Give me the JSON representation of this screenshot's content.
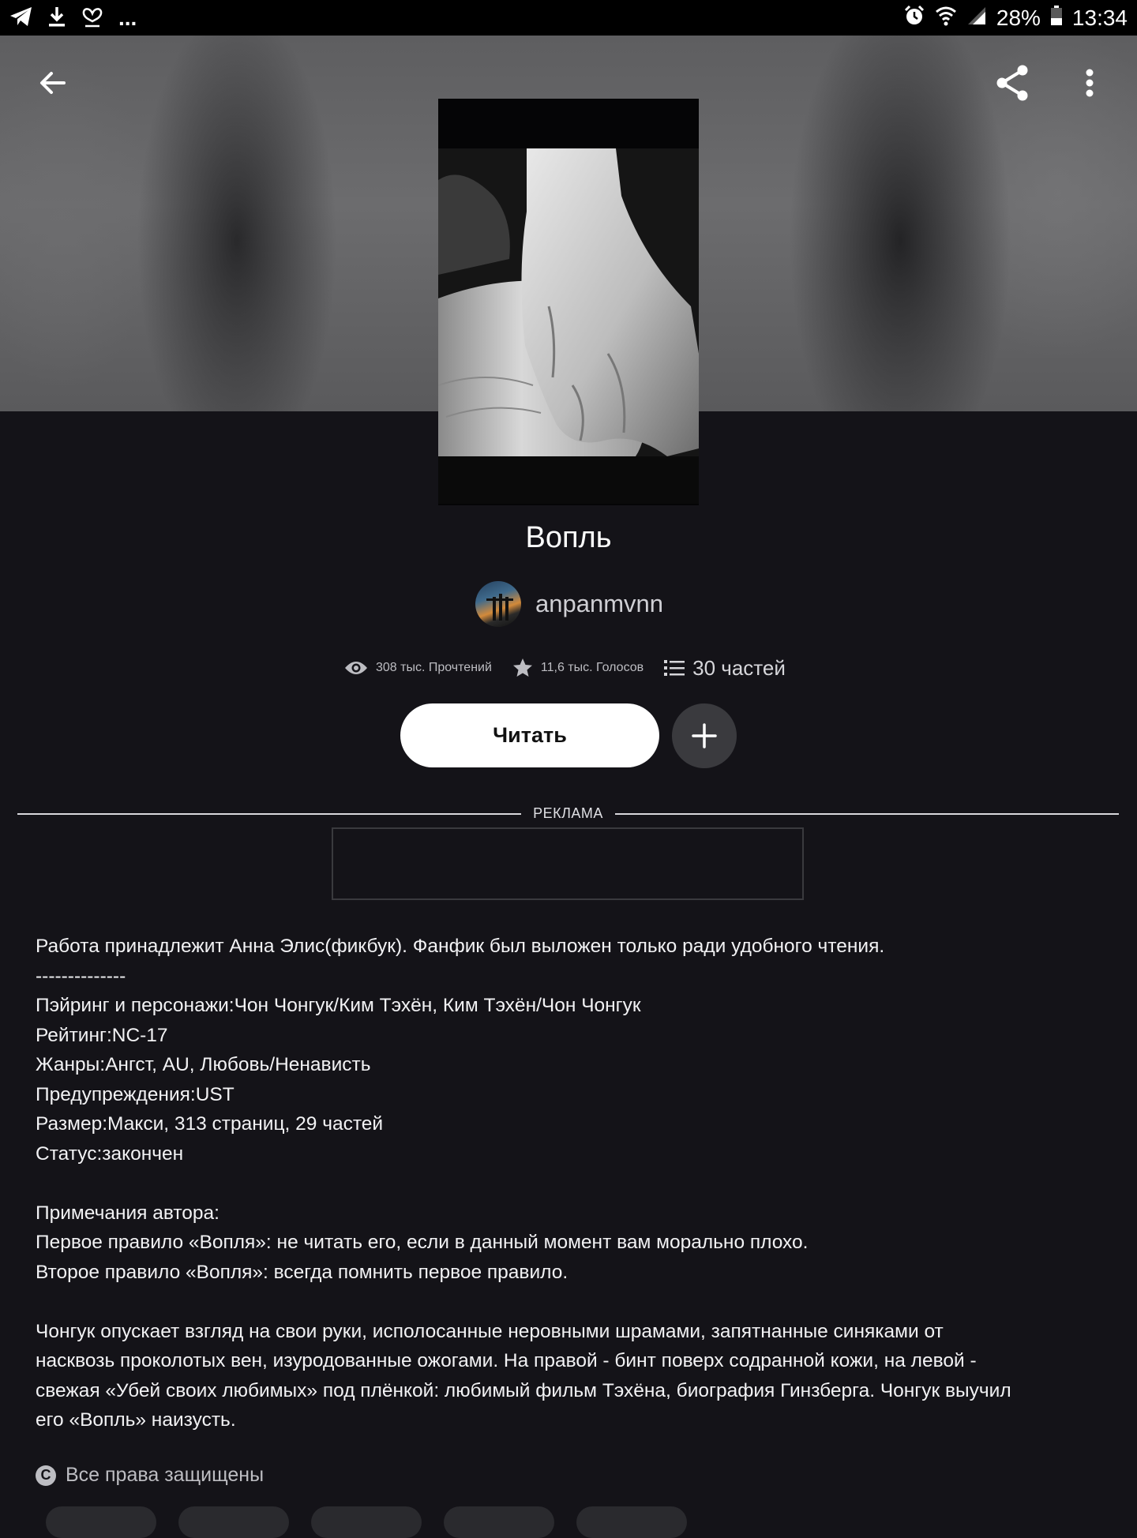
{
  "status_bar": {
    "left_icons": [
      "telegram-icon",
      "download-icon",
      "heart-ribbon-icon"
    ],
    "more": "...",
    "battery": "28%",
    "time": "13:34"
  },
  "header": {
    "back_icon": "arrow-left-icon",
    "share_icon": "share-icon",
    "more_icon": "more-vertical-icon"
  },
  "story": {
    "title": "Вопль",
    "author": "anpanmvnn",
    "reads": "308 тыс. Прочтений",
    "votes": "11,6 тыс. Голосов",
    "parts": "30 частей"
  },
  "actions": {
    "read_label": "Читать",
    "add_icon": "plus-icon"
  },
  "ad": {
    "label": "РЕКЛАМА"
  },
  "description": [
    "Работа принадлежит Анна Элис(фикбук). Фанфик был выложен только ради удобного чтения.",
    "--------------",
    "Пэйринг и персонажи:Чон Чонгук/Ким Тэхён, Ким Тэхён/Чон Чонгук",
    "Рейтинг:NC-17",
    "Жанры:Ангст, AU, Любовь/Ненависть",
    "Предупреждения:UST",
    "Размер:Макси, 313 страниц, 29 частей",
    "Статус:закончен",
    "",
    "Примечания автора:",
    "Первое правило «Вопля»: не читать его, если в данный момент вам морально плохо.",
    "Второе правило «Вопля»: всегда помнить первое правило.",
    "",
    "Чонгук опускает взгляд на свои руки, исполосанные неровными шрамами, запятнанные синяками от",
    "насквозь проколотых вен, изуродованные ожогами. На правой - бинт поверх содранной кожи, на левой -",
    "свежая «Убей своих любимых» под плёнкой: любимый фильм Тэхёна, биография Гинзберга. Чонгук выучил",
    "его «Вопль» наизусть."
  ],
  "footer": {
    "copyright_symbol": "C",
    "copyright": "Все права защищены"
  },
  "colors": {
    "background": "#141318",
    "accent_button": "#ffffff",
    "secondary_button": "#3a3a3e"
  }
}
